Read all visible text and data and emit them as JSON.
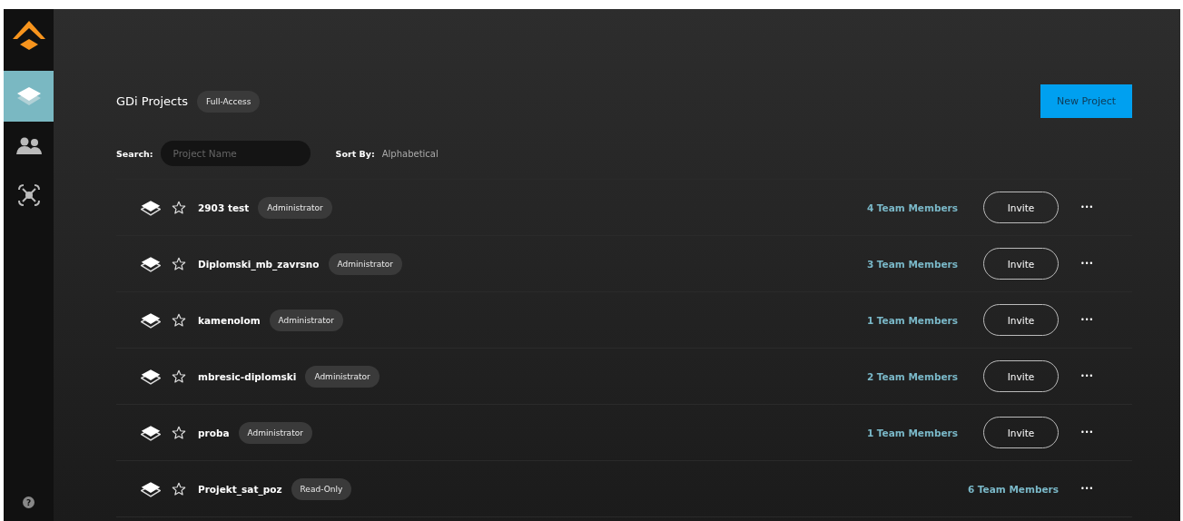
{
  "sidebar": {
    "items": [
      {
        "kind": "layers",
        "selected": true
      },
      {
        "kind": "users",
        "selected": false
      },
      {
        "kind": "drone",
        "selected": false
      }
    ],
    "help": "?"
  },
  "header": {
    "title": "GDi Projects",
    "badge": "Full-Access",
    "new_button": "New Project"
  },
  "search": {
    "label": "Search:",
    "placeholder": "Project Name"
  },
  "sort": {
    "label": "Sort By:",
    "value": "Alphabetical"
  },
  "projects": [
    {
      "name": "2903 test",
      "role": "Administrator",
      "members": "4 Team Members",
      "invite": "Invite",
      "more": "•••",
      "starred": false
    },
    {
      "name": "Diplomski_mb_zavrsno",
      "role": "Administrator",
      "members": "3 Team Members",
      "invite": "Invite",
      "more": "•••",
      "starred": false
    },
    {
      "name": "kamenolom",
      "role": "Administrator",
      "members": "1 Team Members",
      "invite": "Invite",
      "more": "•••",
      "starred": false
    },
    {
      "name": "mbresic-diplomski",
      "role": "Administrator",
      "members": "2 Team Members",
      "invite": "Invite",
      "more": "•••",
      "starred": false
    },
    {
      "name": "proba",
      "role": "Administrator",
      "members": "1 Team Members",
      "invite": "Invite",
      "more": "•••",
      "starred": false
    },
    {
      "name": "Projekt_sat_poz",
      "role": "Read-Only",
      "members": "6 Team Members",
      "more": "•••",
      "starred": false
    }
  ]
}
